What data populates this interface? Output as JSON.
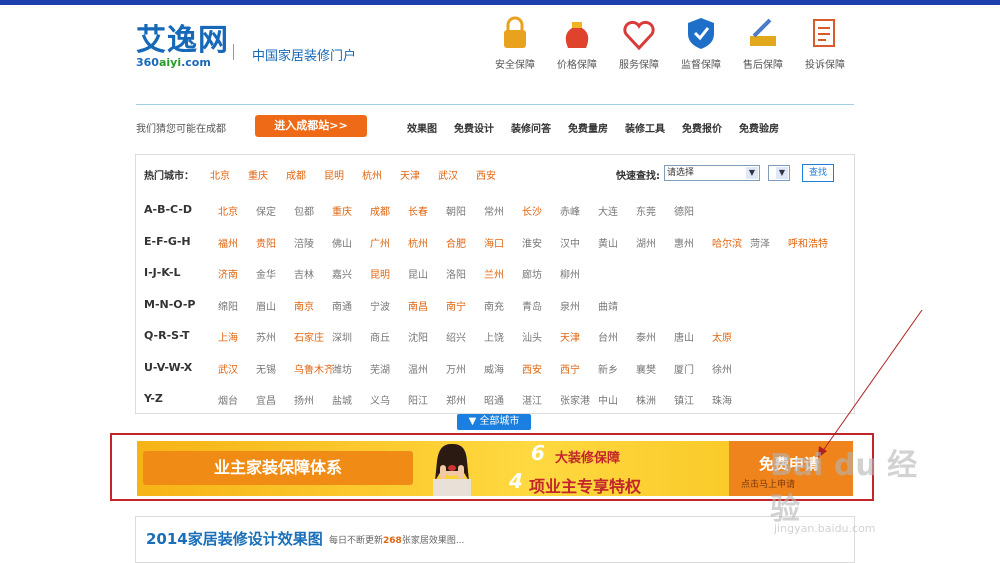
{
  "logo": {
    "main": "艾逸网",
    "domain_pre": "360",
    "domain_mid": "aiyi",
    "domain_post": ".com"
  },
  "slogan": "中国家居装修门户",
  "guarantees": [
    {
      "label": "安全保障",
      "icon": "lock-icon",
      "color": "#e9a21e"
    },
    {
      "label": "价格保障",
      "icon": "money-bag-icon",
      "color": "#e0432c"
    },
    {
      "label": "服务保障",
      "icon": "heart-handshake-icon",
      "color": "#d93a3a"
    },
    {
      "label": "监督保障",
      "icon": "shield-icon",
      "color": "#1e6fc8"
    },
    {
      "label": "售后保障",
      "icon": "tools-icon",
      "color": "#e0a81a"
    },
    {
      "label": "投诉保障",
      "icon": "checklist-icon",
      "color": "#d95a2a"
    }
  ],
  "location": {
    "guess": "我们猜您可能在成都",
    "enter": "进入成都站>>"
  },
  "nav": [
    "效果图",
    "免费设计",
    "装修问答",
    "免费量房",
    "装修工具",
    "免费报价",
    "免费验房"
  ],
  "hot": {
    "label": "热门城市：",
    "cities": [
      "北京",
      "重庆",
      "成都",
      "昆明",
      "杭州",
      "天津",
      "武汉",
      "西安"
    ]
  },
  "quick": {
    "label": "快速查找:",
    "select": "请选择",
    "search": "查找"
  },
  "rows": [
    {
      "label": "A-B-C-D",
      "cities": [
        [
          "北京",
          1
        ],
        [
          "保定",
          0
        ],
        [
          "包都",
          0
        ],
        [
          "重庆",
          1
        ],
        [
          "成都",
          1
        ],
        [
          "长春",
          1
        ],
        [
          "朝阳",
          0
        ],
        [
          "常州",
          0
        ],
        [
          "长沙",
          1
        ],
        [
          "赤峰",
          0
        ],
        [
          "大连",
          0
        ],
        [
          "东莞",
          0
        ],
        [
          "德阳",
          0
        ]
      ]
    },
    {
      "label": "E-F-G-H",
      "cities": [
        [
          "福州",
          1
        ],
        [
          "贵阳",
          1
        ],
        [
          "涪陵",
          0
        ],
        [
          "佛山",
          0
        ],
        [
          "广州",
          1
        ],
        [
          "杭州",
          1
        ],
        [
          "合肥",
          1
        ],
        [
          "海口",
          1
        ],
        [
          "淮安",
          0
        ],
        [
          "汉中",
          0
        ],
        [
          "黄山",
          0
        ],
        [
          "湖州",
          0
        ],
        [
          "惠州",
          0
        ],
        [
          "哈尔滨",
          1
        ],
        [
          "菏泽",
          0
        ],
        [
          "呼和浩特",
          1
        ]
      ]
    },
    {
      "label": "I-J-K-L",
      "cities": [
        [
          "济南",
          1
        ],
        [
          "金华",
          0
        ],
        [
          "吉林",
          0
        ],
        [
          "嘉兴",
          0
        ],
        [
          "昆明",
          1
        ],
        [
          "昆山",
          0
        ],
        [
          "洛阳",
          0
        ],
        [
          "兰州",
          1
        ],
        [
          "廊坊",
          0
        ],
        [
          "柳州",
          0
        ]
      ]
    },
    {
      "label": "M-N-O-P",
      "cities": [
        [
          "绵阳",
          0
        ],
        [
          "眉山",
          0
        ],
        [
          "南京",
          1
        ],
        [
          "南通",
          0
        ],
        [
          "宁波",
          0
        ],
        [
          "南昌",
          1
        ],
        [
          "南宁",
          1
        ],
        [
          "南充",
          0
        ],
        [
          "青岛",
          0
        ],
        [
          "泉州",
          0
        ],
        [
          "曲靖",
          0
        ]
      ]
    },
    {
      "label": "Q-R-S-T",
      "cities": [
        [
          "上海",
          1
        ],
        [
          "苏州",
          0
        ],
        [
          "石家庄",
          1
        ],
        [
          "深圳",
          0
        ],
        [
          "商丘",
          0
        ],
        [
          "沈阳",
          0
        ],
        [
          "绍兴",
          0
        ],
        [
          "上饶",
          0
        ],
        [
          "汕头",
          0
        ],
        [
          "天津",
          1
        ],
        [
          "台州",
          0
        ],
        [
          "泰州",
          0
        ],
        [
          "唐山",
          0
        ],
        [
          "太原",
          1
        ]
      ]
    },
    {
      "label": "U-V-W-X",
      "cities": [
        [
          "武汉",
          1
        ],
        [
          "无锡",
          0
        ],
        [
          "乌鲁木齐",
          1
        ],
        [
          "潍坊",
          0
        ],
        [
          "芜湖",
          0
        ],
        [
          "温州",
          0
        ],
        [
          "万州",
          0
        ],
        [
          "威海",
          0
        ],
        [
          "西安",
          1
        ],
        [
          "西宁",
          1
        ],
        [
          "新乡",
          0
        ],
        [
          "襄樊",
          0
        ],
        [
          "厦门",
          0
        ],
        [
          "徐州",
          0
        ]
      ]
    },
    {
      "label": "Y-Z",
      "cities": [
        [
          "烟台",
          0
        ],
        [
          "宜昌",
          0
        ],
        [
          "扬州",
          0
        ],
        [
          "盐城",
          0
        ],
        [
          "义乌",
          0
        ],
        [
          "阳江",
          0
        ],
        [
          "郑州",
          0
        ],
        [
          "昭通",
          0
        ],
        [
          "湛江",
          0
        ],
        [
          "张家港",
          0
        ],
        [
          "中山",
          0
        ],
        [
          "株洲",
          0
        ],
        [
          "镇江",
          0
        ],
        [
          "珠海",
          0
        ]
      ]
    }
  ],
  "all_cities": "全部城市",
  "banner": {
    "left": "业主家装保障体系",
    "n1": "6",
    "line1": "大装修保障",
    "n2": "4",
    "line2": "项业主专享特权",
    "apply": "免费申请",
    "apply_sub": "点击马上申请"
  },
  "section": {
    "title": "2014家居装修设计效果图",
    "sub_pre": "每日不断更新",
    "count": "268",
    "sub_post": "张家居效果图..."
  },
  "watermark": {
    "main": "Bai du 经验",
    "sub": "jingyan.baidu.com"
  },
  "colors": {
    "brand": "#1668b8",
    "accent": "#ee6a17",
    "highlight": "#e06510",
    "frame": "#c2262a"
  }
}
